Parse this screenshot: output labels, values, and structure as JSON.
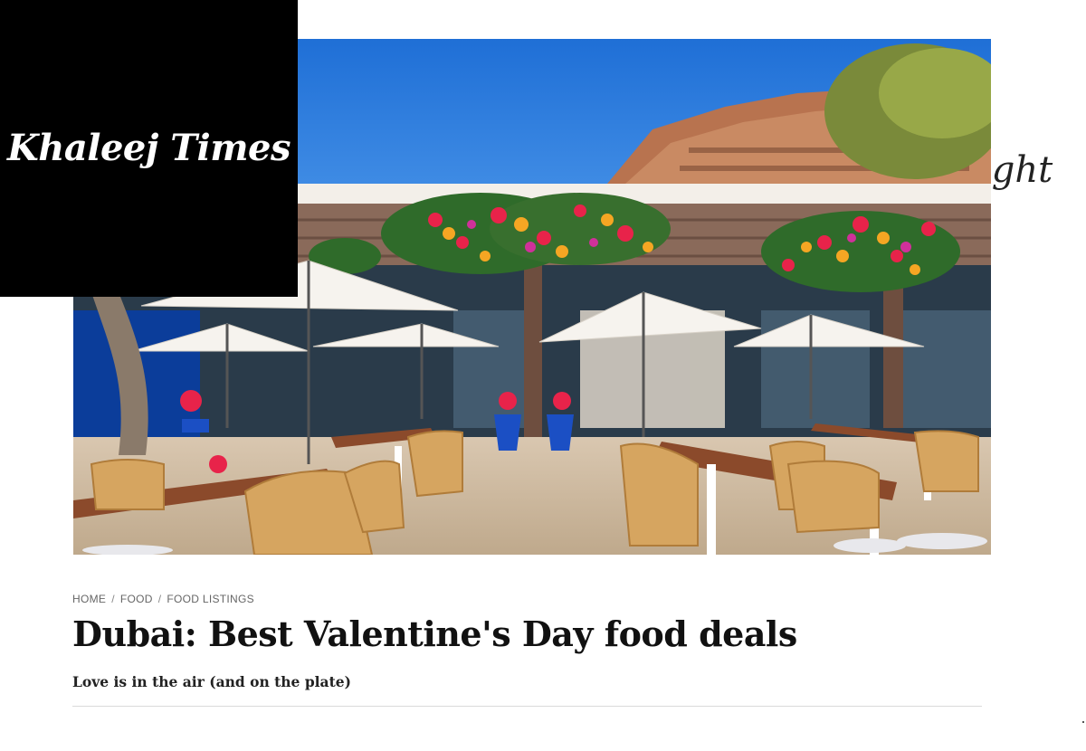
{
  "logo": {
    "text": "Khaleej Times"
  },
  "background_word": "ight",
  "hero": {
    "alt": "Outdoor terrace restaurant with white umbrellas, wicker chairs and flower garlands"
  },
  "breadcrumb": {
    "items": [
      "HOME",
      "FOOD",
      "FOOD LISTINGS"
    ],
    "separator": "/"
  },
  "article": {
    "title": "Dubai: Best Valentine's Day food deals",
    "subtitle": "Love is in the air (and on the plate)"
  },
  "colors": {
    "logo_bg": "#000000",
    "logo_text": "#ffffff",
    "title": "#111111",
    "breadcrumb": "#666666",
    "divider": "#d9d9d9"
  }
}
